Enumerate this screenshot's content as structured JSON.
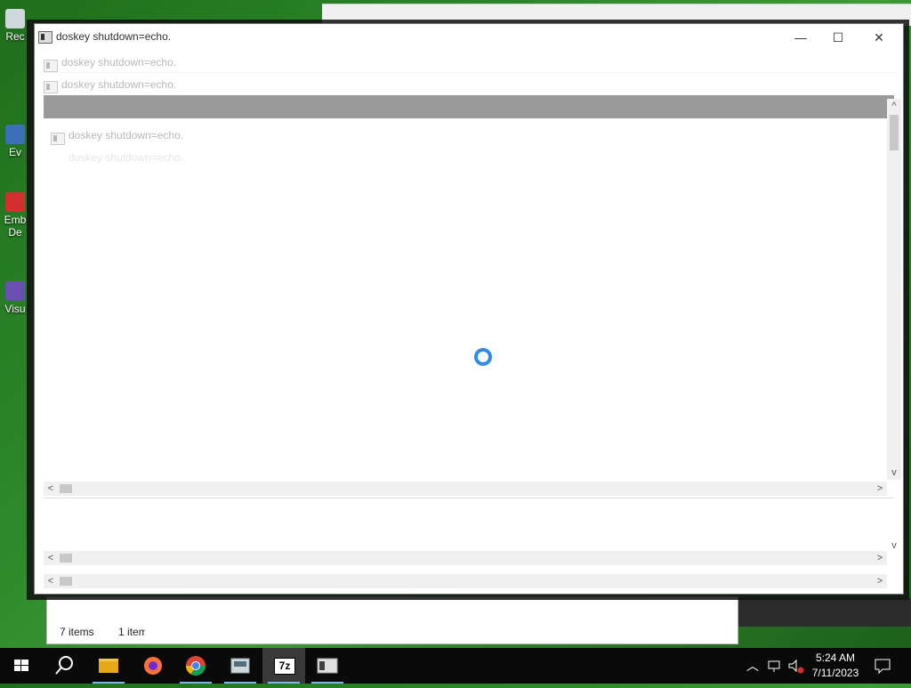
{
  "desktop": {
    "icons": [
      {
        "label": "Rec"
      },
      {
        "label": "Ev"
      },
      {
        "label": "Emb"
      },
      {
        "label": "De"
      },
      {
        "label": "Visu"
      }
    ]
  },
  "explorer": {
    "items_count": "7 items",
    "selection": "1 item s"
  },
  "windows": {
    "main_title": "doskey  shutdown=echo.",
    "ghost_title_1": "doskey  shutdown=echo.",
    "ghost_title_2": "doskey  shutdown=echo.",
    "ghost_title_3": "doskey  shutdown=echo.",
    "ghost_title_4": "doskey  shutdown=echo."
  },
  "controls": {
    "minimize": "—",
    "maximize": "☐",
    "close": "✕"
  },
  "scroll": {
    "up": "^",
    "down": "v",
    "left": "<",
    "right": ">"
  },
  "taskbar": {
    "apps": [
      {
        "name": "start-icon"
      },
      {
        "name": "search-icon"
      },
      {
        "name": "file-explorer-icon"
      },
      {
        "name": "firefox-icon"
      },
      {
        "name": "chrome-icon"
      },
      {
        "name": "app-icon"
      },
      {
        "name": "7zip-icon"
      },
      {
        "name": "console-icon"
      }
    ],
    "sevenzip_label": "7z",
    "time": "5:24 AM",
    "date": "7/11/2023"
  }
}
